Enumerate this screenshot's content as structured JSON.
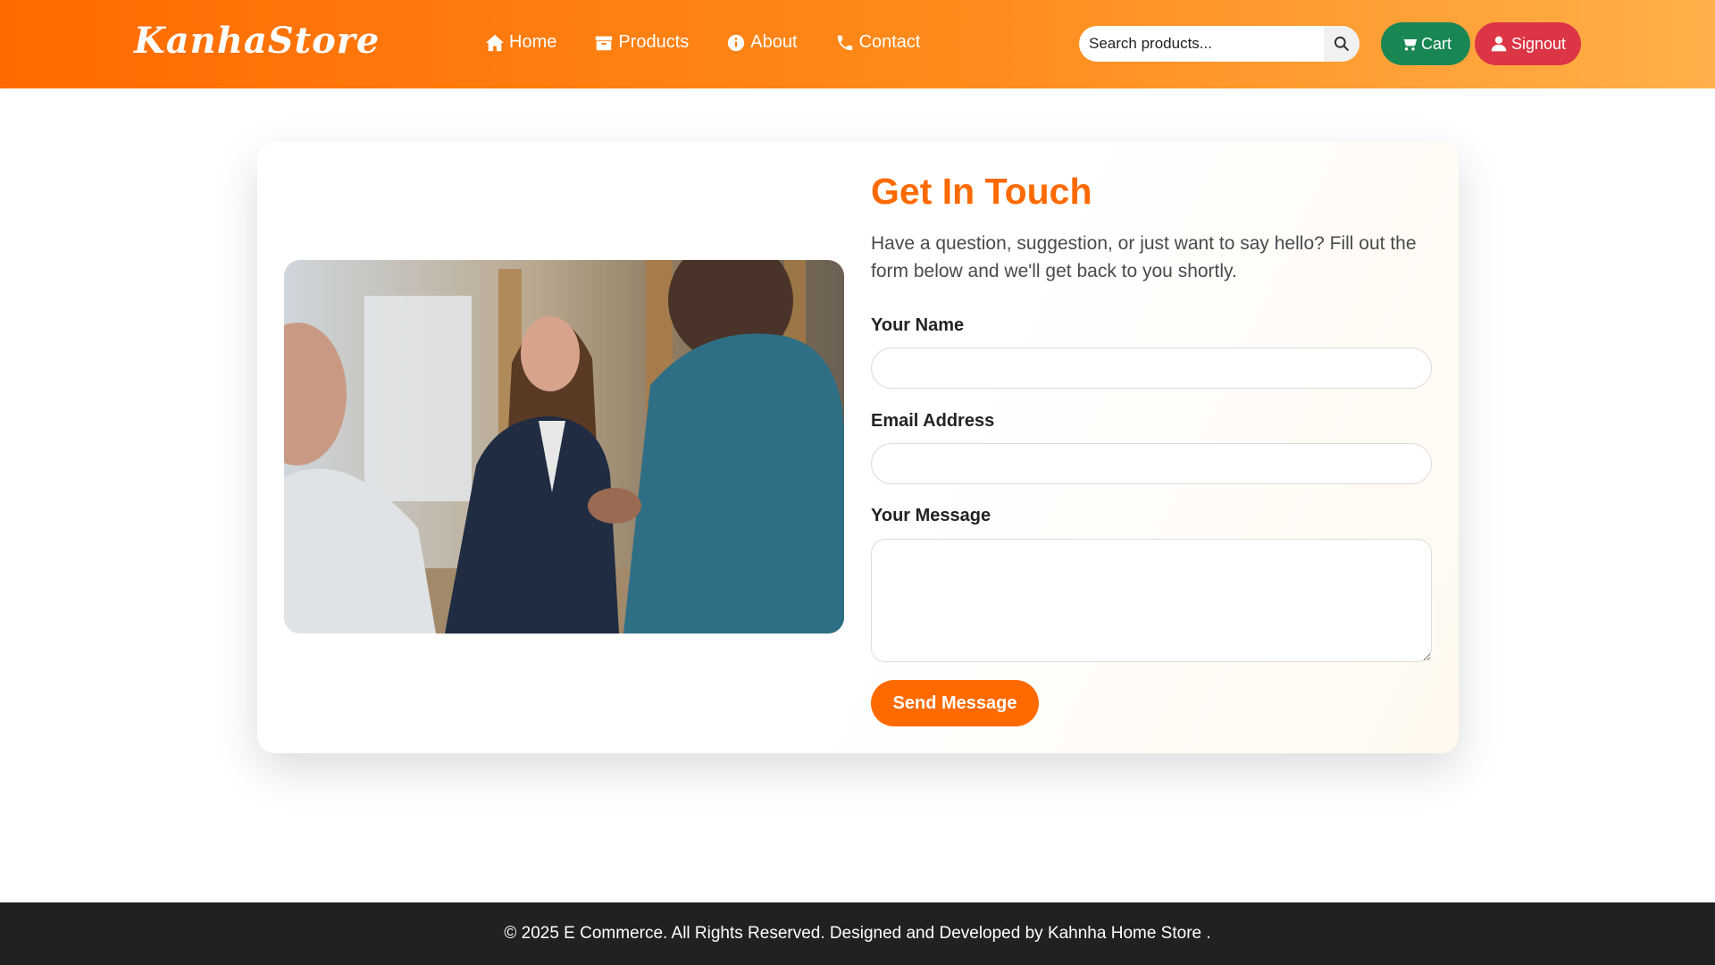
{
  "brand": {
    "name": "KanhaStore"
  },
  "nav": {
    "items": [
      {
        "label": "Home",
        "icon": "home-icon"
      },
      {
        "label": "Products",
        "icon": "box-icon"
      },
      {
        "label": "About",
        "icon": "info-icon"
      },
      {
        "label": "Contact",
        "icon": "phone-icon"
      }
    ]
  },
  "search": {
    "placeholder": "Search products...",
    "value": "",
    "icon": "search-icon"
  },
  "actions": {
    "cart_label": "Cart",
    "signout_label": "Signout"
  },
  "contact": {
    "heading": "Get In Touch",
    "intro": "Have a question, suggestion, or just want to say hello? Fill out the form below and we'll get back to you shortly.",
    "name_label": "Your Name",
    "name_value": "",
    "email_label": "Email Address",
    "email_value": "",
    "message_label": "Your Message",
    "message_value": "",
    "submit_label": "Send Message"
  },
  "footer": {
    "text": "© 2025 E Commerce. All Rights Reserved. Designed and Developed by Kahnha Home Store ."
  },
  "colors": {
    "accent": "#ff6a00",
    "cart": "#198754",
    "signout": "#dc3545",
    "footer_bg": "#212121"
  }
}
